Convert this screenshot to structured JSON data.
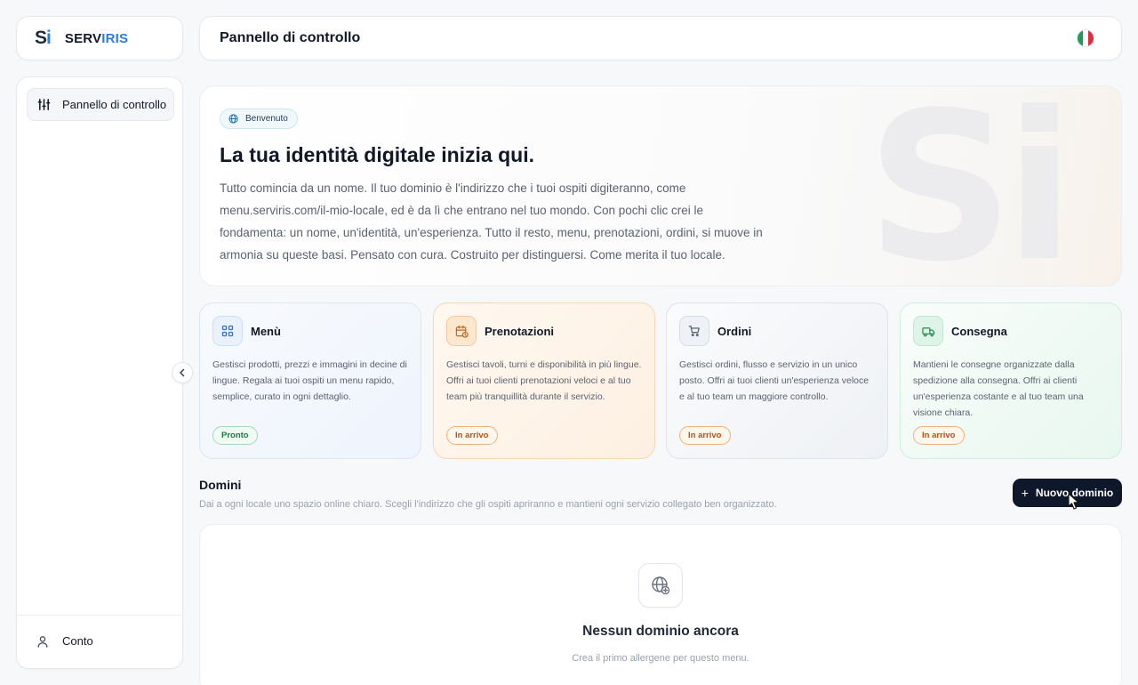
{
  "brand": {
    "mark_s": "S",
    "mark_i": "i",
    "name_a": "SERV",
    "name_b": "IRIS"
  },
  "header": {
    "title": "Pannello di controllo",
    "language_flag": "italian-flag-icon"
  },
  "sidebar": {
    "items": [
      {
        "label": "Pannello di controllo",
        "icon": "sliders-icon",
        "active": true
      }
    ],
    "footer": {
      "label": "Conto",
      "icon": "user-icon"
    }
  },
  "hero": {
    "badge": "Benvenuto",
    "title": "La tua identità digitale inizia qui.",
    "text": "Tutto comincia da un nome. Il tuo dominio è l'indirizzo che i tuoi ospiti digiteranno, come menu.serviris.com/il-mio-locale, ed è da lì che entrano nel tuo mondo. Con pochi clic crei le fondamenta: un nome, un'identità, un'esperienza. Tutto il resto, menu, prenotazioni, ordini, si muove in armonia su queste basi. Pensato con cura. Costruito per distinguersi. Come merita il tuo locale.",
    "watermark": "Si"
  },
  "features": [
    {
      "title": "Menù",
      "icon": "grid-icon",
      "text": "Gestisci prodotti, prezzi e immagini in decine di lingue. Regala ai tuoi ospiti un menu rapido, semplice, curato in ogni dettaglio.",
      "status": "Pronto"
    },
    {
      "title": "Prenotazioni",
      "icon": "calendar-clock-icon",
      "text": "Gestisci tavoli, turni e disponibilità in più lingue. Offri ai tuoi clienti prenotazioni veloci e al tuo team più tranquillità durante il servizio.",
      "status": "In arrivo"
    },
    {
      "title": "Ordini",
      "icon": "cart-icon",
      "text": "Gestisci ordini, flusso e servizio in un unico posto. Offri ai tuoi clienti un'esperienza veloce e al tuo team un maggiore controllo.",
      "status": "In arrivo"
    },
    {
      "title": "Consegna",
      "icon": "truck-icon",
      "text": "Mantieni le consegne organizzate dalla spedizione alla consegna. Offri ai clienti un'esperienza costante e al tuo team una visione chiara.",
      "status": "In arrivo"
    }
  ],
  "domains": {
    "title": "Domini",
    "subtitle": "Dai a ogni locale uno spazio online chiaro. Scegli l'indirizzo che gli ospiti apriranno e mantieni ogni servizio collegato ben organizzato.",
    "new_button": "Nuovo dominio",
    "new_button_icon": "+",
    "empty_title": "Nessun dominio ancora",
    "empty_subtitle": "Crea il primo allergene per questo menu."
  },
  "colors": {
    "accent": "#2c7be5",
    "dark_button": "#0f172a",
    "status_ready": "#1d7a43",
    "status_coming": "#b4531b"
  }
}
